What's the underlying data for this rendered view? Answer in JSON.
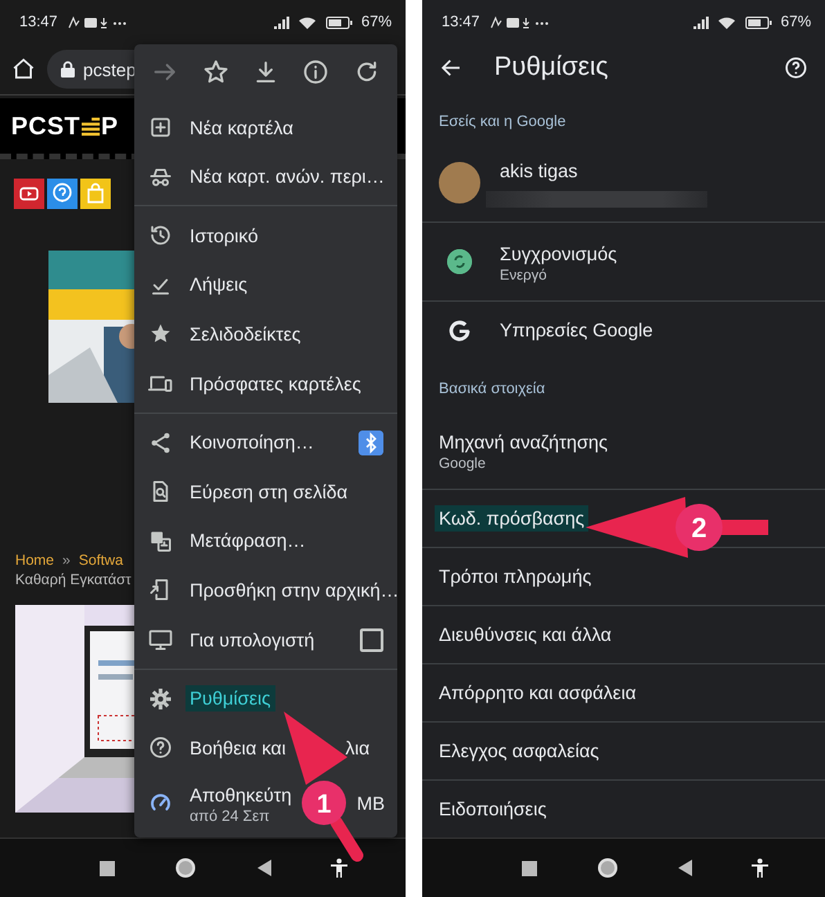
{
  "left_phone": {
    "status_bar": {
      "time": "13:47",
      "battery": "67%"
    },
    "url_bar": {
      "url": "pcstep"
    },
    "page": {
      "logo": "PCST",
      "logo_tail": "P",
      "breadcrumb": [
        {
          "label": "Home",
          "kind": "link"
        },
        {
          "label": "»",
          "kind": "separator"
        },
        {
          "label": "Softwa",
          "kind": "link"
        }
      ],
      "article_title": "Καθαρή Εγκατάστ"
    },
    "menu": {
      "toolbar": [
        {
          "disabled": true
        },
        {
          "disabled": false
        },
        {
          "disabled": false
        },
        {
          "disabled": false
        },
        {
          "disabled": false
        }
      ],
      "sections": [
        [
          {
            "kind": "plain",
            "label": "Νέα καρτέλα",
            "highlighted": false
          },
          {
            "kind": "plain",
            "label": "Νέα καρτ. ανών. περι…",
            "highlighted": false
          }
        ],
        [
          {
            "kind": "plain",
            "label": "Ιστορικό",
            "highlighted": false
          },
          {
            "kind": "plain",
            "label": "Λήψεις",
            "highlighted": false
          },
          {
            "kind": "plain",
            "label": "Σελιδοδείκτες",
            "highlighted": false
          },
          {
            "kind": "plain",
            "label": "Πρόσφατες καρτέλες",
            "highlighted": false
          }
        ],
        [
          {
            "kind": "badge",
            "label": "Κοινοποίηση…",
            "highlighted": false
          },
          {
            "kind": "plain",
            "label": "Εύρεση στη σελίδα",
            "highlighted": false
          },
          {
            "kind": "plain",
            "label": "Μετάφραση…",
            "highlighted": false
          },
          {
            "kind": "plain",
            "label": "Προσθήκη στην αρχική…",
            "highlighted": false
          },
          {
            "kind": "checkbox",
            "label": "Για υπολογιστή",
            "checked": false,
            "highlighted": false
          }
        ],
        [
          {
            "kind": "plain",
            "label": "Ρυθμίσεις",
            "highlighted": true
          },
          {
            "kind": "split",
            "label": "Βοήθεια και",
            "label_end": "λια",
            "highlighted": false
          },
          {
            "kind": "savings",
            "label": "Αποθηκεύτη",
            "label_end": "MB",
            "subtitle": "από 24 Σεπ",
            "highlighted": false
          }
        ]
      ]
    },
    "annotation": {
      "number": "1"
    }
  },
  "right_phone": {
    "status_bar": {
      "time": "13:47",
      "battery": "67%"
    },
    "title": "Ρυθμίσεις",
    "sections": [
      {
        "header": "Εσείς και η Google",
        "items": [
          {
            "kind": "account",
            "label": "akis tigas",
            "highlighted": false
          },
          {
            "kind": "sync",
            "label": "Συγχρονισμός",
            "subtitle": "Ενεργό",
            "highlighted": false
          },
          {
            "kind": "google",
            "label": "Υπηρεσίες Google",
            "highlighted": false
          }
        ]
      },
      {
        "header": "Βασικά στοιχεία",
        "items": [
          {
            "kind": "plain",
            "label": "Μηχανή αναζήτησης",
            "subtitle": "Google",
            "highlighted": false
          },
          {
            "kind": "plain",
            "label": "Κωδ. πρόσβασης",
            "highlighted": true
          },
          {
            "kind": "plain",
            "label": "Τρόποι πληρωμής",
            "highlighted": false
          },
          {
            "kind": "plain",
            "label": "Διευθύνσεις και άλλα",
            "highlighted": false
          },
          {
            "kind": "plain",
            "label": "Απόρρητο και ασφάλεια",
            "highlighted": false
          },
          {
            "kind": "plain",
            "label": "Ελεγχος ασφαλείας",
            "highlighted": false
          },
          {
            "kind": "plain",
            "label": "Ειδοποιήσεις",
            "highlighted": false
          }
        ]
      }
    ],
    "annotation": {
      "number": "2"
    }
  }
}
